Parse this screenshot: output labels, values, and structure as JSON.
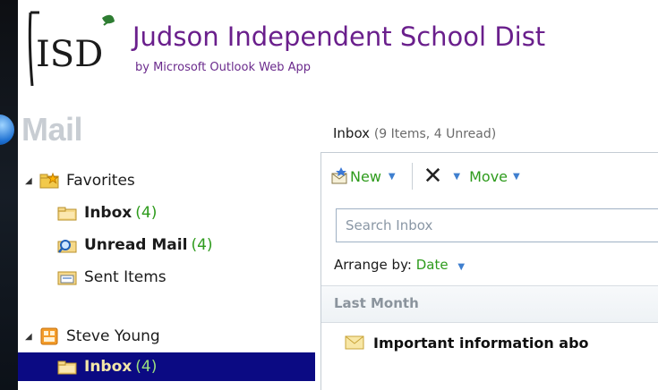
{
  "header": {
    "logo_text": "JISD",
    "org_title": "Judson Independent School Dist",
    "by_line": "by Microsoft Outlook Web App"
  },
  "module": {
    "title": "Mail"
  },
  "nav": {
    "favorites_label": "Favorites",
    "favorites_items": [
      {
        "label": "Inbox",
        "count": "(4)",
        "icon": "folder-icon"
      },
      {
        "label": "Unread Mail",
        "count": "(4)",
        "icon": "search-folder-icon"
      },
      {
        "label": "Sent Items",
        "count": "",
        "icon": "sent-items-icon"
      }
    ],
    "account_label": "Steve Young",
    "account_items": [
      {
        "label": "Inbox",
        "count": "(4)",
        "icon": "folder-icon",
        "selected": true
      }
    ]
  },
  "pane": {
    "folder_title": "Inbox",
    "folder_meta": "(9 Items, 4 Unread)",
    "toolbar": {
      "new_label": "New",
      "move_label": "Move"
    },
    "search": {
      "placeholder": "Search Inbox"
    },
    "arrange": {
      "label": "Arrange by:",
      "value": "Date"
    },
    "group_label": "Last Month",
    "messages": [
      {
        "subject": "Important information abo"
      }
    ]
  },
  "colors": {
    "brand_purple": "#6a1f8c",
    "accent_green": "#2e9b1c",
    "selection": "#0b0a83"
  }
}
